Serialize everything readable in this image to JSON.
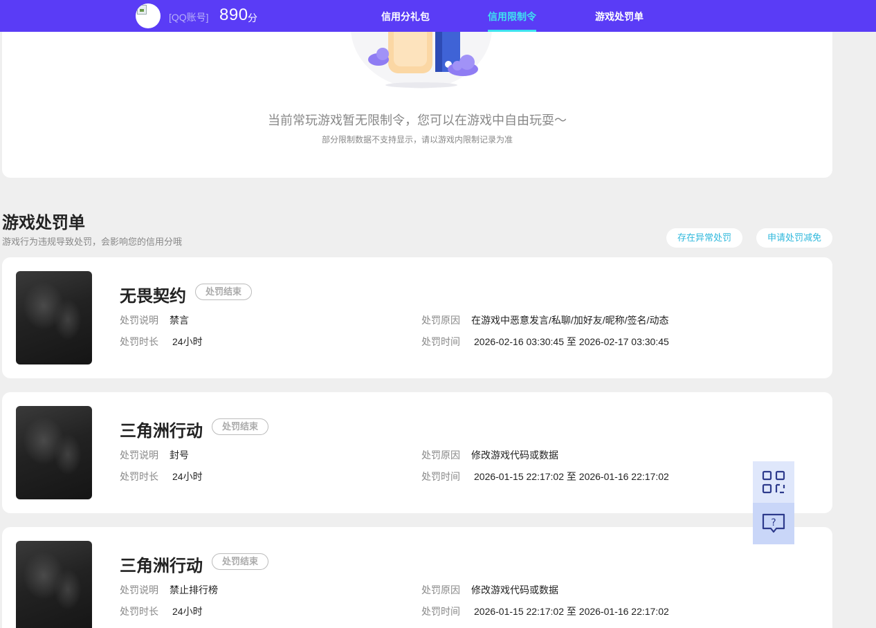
{
  "header": {
    "account_label": "[QQ账号]",
    "score": "890",
    "score_unit": "分",
    "nav": [
      {
        "label": "信用分礼包",
        "active": false
      },
      {
        "label": "信用限制令",
        "active": true
      },
      {
        "label": "游戏处罚单",
        "active": false
      }
    ]
  },
  "restriction": {
    "message": "当前常玩游戏暂无限制令，您可以在游戏中自由玩耍～",
    "sub_message": "部分限制数据不支持显示，请以游戏内限制记录为准"
  },
  "penalty_section": {
    "title": "游戏处罚单",
    "description": "游戏行为违规导致处罚，会影响您的信用分哦",
    "buttons": {
      "abnormal": "存在异常处罚",
      "reduce": "申请处罚减免"
    },
    "field_labels": {
      "desc": "处罚说明",
      "duration": "处罚时长",
      "reason": "处罚原因",
      "time": "处罚时间"
    },
    "records": [
      {
        "game": "无畏契约",
        "status": "处罚结束",
        "desc": "禁言",
        "duration": "24小时",
        "reason": "在游戏中恶意发言/私聊/加好友/昵称/签名/动态",
        "time": "2026-02-16 03:30:45 至 2026-02-17 03:30:45"
      },
      {
        "game": "三角洲行动",
        "status": "处罚结束",
        "desc": "封号",
        "duration": "24小时",
        "reason": "修改游戏代码或数据",
        "time": "2026-01-15 22:17:02 至 2026-01-16 22:17:02"
      },
      {
        "game": "三角洲行动",
        "status": "处罚结束",
        "desc": "禁止排行榜",
        "duration": "24小时",
        "reason": "修改游戏代码或数据",
        "time": "2026-01-15 22:17:02 至 2026-01-16 22:17:02"
      }
    ]
  },
  "colors": {
    "header_bg": "#5a3cf6",
    "nav_active": "#3fe3f0",
    "pill_text": "#2fb8dc",
    "page_bg": "#efefef"
  },
  "icons": {
    "float_qr": "qr-code-icon",
    "float_help": "help-chat-icon"
  }
}
